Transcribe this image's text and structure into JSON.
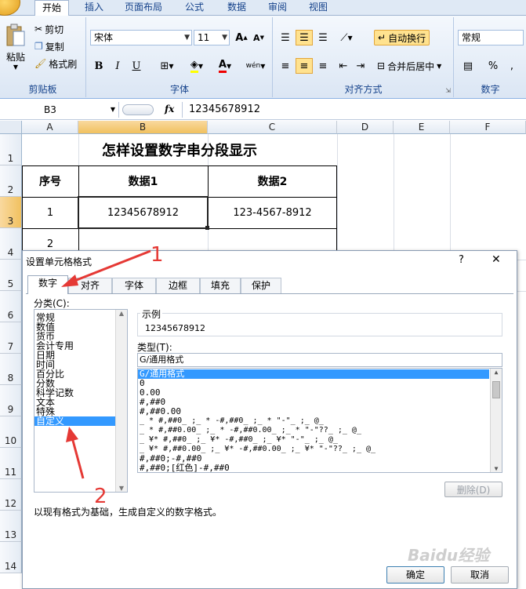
{
  "ribbon": {
    "tabs": [
      "开始",
      "插入",
      "页面布局",
      "公式",
      "数据",
      "审阅",
      "视图"
    ],
    "active_tab": "开始",
    "clipboard": {
      "paste": "粘贴",
      "cut": "剪切",
      "copy": "复制",
      "format_painter": "格式刷",
      "label": "剪贴板"
    },
    "font": {
      "name": "宋体",
      "size": "11",
      "grow": "A",
      "shrink": "A",
      "bold": "B",
      "italic": "I",
      "underline": "U",
      "color_letter": "A",
      "phonetic": "wén",
      "label": "字体"
    },
    "alignment": {
      "wrap_text": "自动换行",
      "merge_center": "合并后居中",
      "label": "对齐方式"
    },
    "number": {
      "format": "常规",
      "percent": "%",
      "comma": ",",
      "label": "数字"
    }
  },
  "formula_bar": {
    "cell_ref": "B3",
    "fx": "fx",
    "value": "12345678912"
  },
  "sheet": {
    "columns": [
      "A",
      "B",
      "C",
      "D",
      "E",
      "F"
    ],
    "rows": [
      "1",
      "2",
      "3",
      "4",
      "5",
      "6",
      "7",
      "8",
      "9",
      "10",
      "11",
      "12",
      "13",
      "14"
    ],
    "title": "怎样设置数字串分段显示",
    "headers": [
      "序号",
      "数据1",
      "数据2"
    ],
    "row3": [
      "1",
      "12345678912",
      "123-4567-8912"
    ],
    "row4_a": "2"
  },
  "dialog": {
    "title": "设置单元格格式",
    "help": "?",
    "close": "✕",
    "tabs": [
      "数字",
      "对齐",
      "字体",
      "边框",
      "填充",
      "保护"
    ],
    "category_label": "分类(C):",
    "categories": [
      "常规",
      "数值",
      "货币",
      "会计专用",
      "日期",
      "时间",
      "百分比",
      "分数",
      "科学记数",
      "文本",
      "特殊",
      "自定义"
    ],
    "selected_category": "自定义",
    "sample_label": "示例",
    "sample_value": "12345678912",
    "type_label": "类型(T):",
    "type_value": "G/通用格式",
    "formats": [
      "G/通用格式",
      "0",
      "0.00",
      "#,##0",
      "#,##0.00",
      "_ * #,##0_ ;_ * -#,##0_ ;_ * \"-\"_ ;_ @_",
      "_ * #,##0.00_ ;_ * -#,##0.00_ ;_ * \"-\"??_ ;_ @_",
      "_ ¥* #,##0_ ;_ ¥* -#,##0_ ;_ ¥* \"-\"_ ;_ @_",
      "_ ¥* #,##0.00_ ;_ ¥* -#,##0.00_ ;_ ¥* \"-\"??_ ;_ @_",
      "#,##0;-#,##0",
      "#,##0;[红色]-#,##0"
    ],
    "delete_button": "删除(D)",
    "description": "以现有格式为基础，生成自定义的数字格式。",
    "ok": "确定",
    "cancel": "取消"
  },
  "annotations": {
    "step1": "1",
    "step2": "2"
  },
  "watermark": "Baidu经验"
}
